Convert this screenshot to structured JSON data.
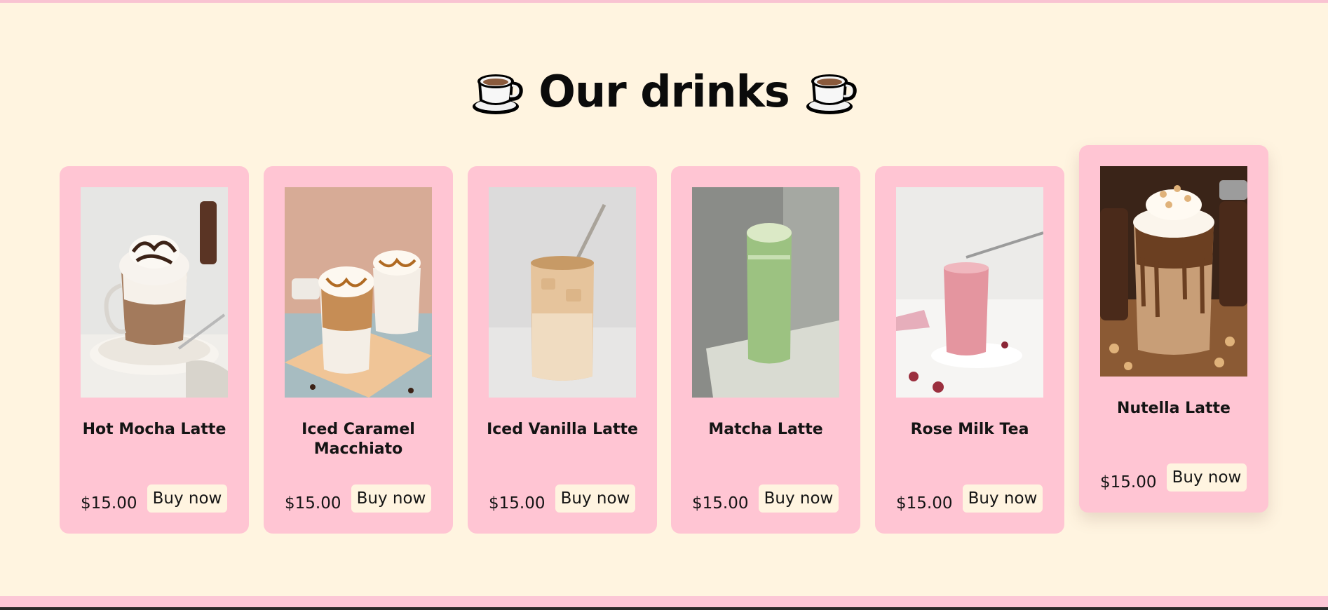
{
  "heading": {
    "title": "Our drinks",
    "icon_left": "coffee-cup-icon",
    "icon_right": "coffee-cup-icon"
  },
  "colors": {
    "background": "#fff4e0",
    "card": "#ffc5d3",
    "button": "#fff4e0",
    "accent_border": "#f9c3d2",
    "text": "#141414"
  },
  "drinks": [
    {
      "name": "Hot Mocha Latte",
      "price": "$15.00",
      "button": "Buy now",
      "photo": "hot-mocha-latte-photo"
    },
    {
      "name": "Iced Caramel Macchiato",
      "price": "$15.00",
      "button": "Buy now",
      "photo": "iced-caramel-macchiato-photo"
    },
    {
      "name": "Iced Vanilla Latte",
      "price": "$15.00",
      "button": "Buy now",
      "photo": "iced-vanilla-latte-photo"
    },
    {
      "name": "Matcha Latte",
      "price": "$15.00",
      "button": "Buy now",
      "photo": "matcha-latte-photo"
    },
    {
      "name": "Rose Milk Tea",
      "price": "$15.00",
      "button": "Buy now",
      "photo": "rose-milk-tea-photo"
    },
    {
      "name": "Nutella Latte",
      "price": "$15.00",
      "button": "Buy now",
      "photo": "nutella-latte-photo"
    }
  ]
}
